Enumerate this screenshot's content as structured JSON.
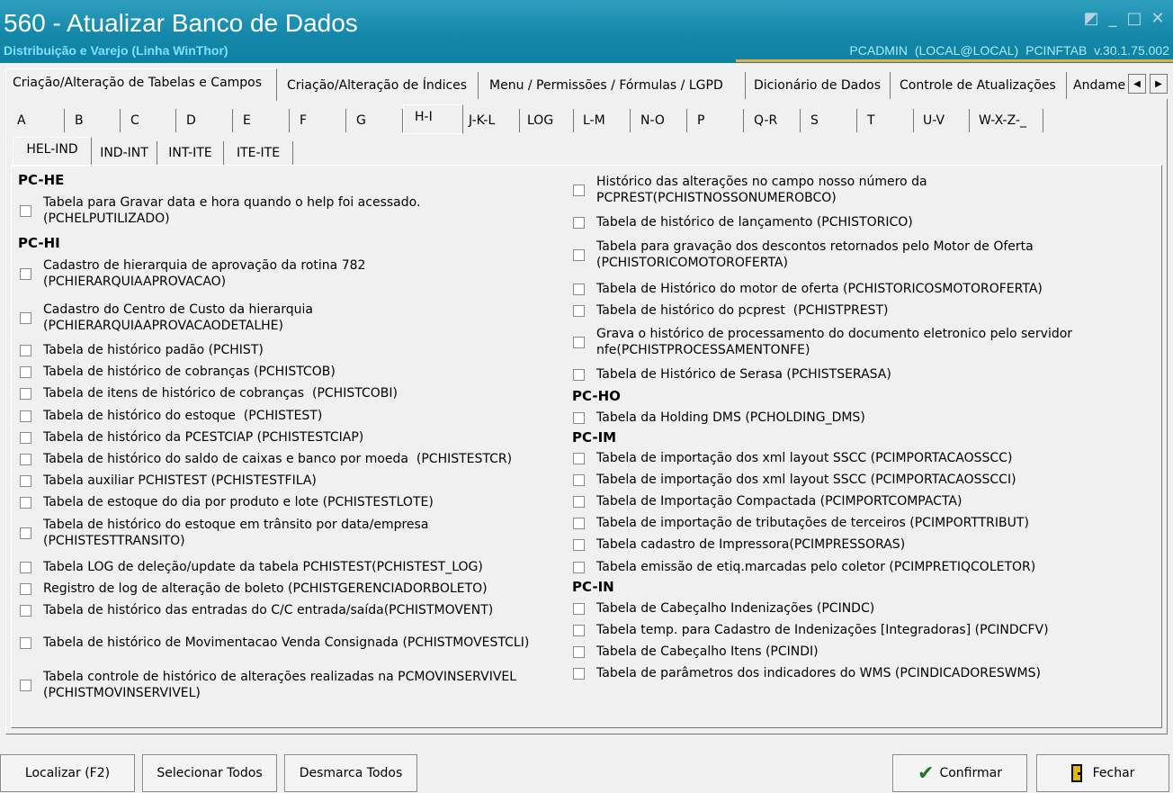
{
  "window": {
    "title": "560 - Atualizar Banco de Dados",
    "subtitle": "Distribuição e Varejo (Linha WinThor)",
    "user_info": "PCADMIN (LOCAL@LOCAL)   PCINFTAB  v.30.1.75.002",
    "restore_glyph": "◩",
    "minimize_glyph": "_",
    "maximize_glyph": "□",
    "close_glyph": "✕"
  },
  "main_tabs": [
    {
      "label": "Criação/Alteração de Tabelas e Campos"
    },
    {
      "label": "Criação/Alteração de Índices"
    },
    {
      "label": "Menu / Permissões / Fórmulas / LGPD"
    },
    {
      "label": "Dicionário de Dados"
    },
    {
      "label": "Controle de Atualizações"
    },
    {
      "label": "Andamento"
    }
  ],
  "scroll": {
    "left": "◀",
    "right": "▶"
  },
  "letter_tabs": [
    "A",
    "B",
    "C",
    "D",
    "E",
    "F",
    "G",
    "H-I",
    "J-K-L",
    "LOG",
    "L-M",
    "N-O",
    "P",
    "Q-R",
    "S",
    "T",
    "U-V",
    "W-X-Z-_"
  ],
  "sub_tabs": [
    "HEL-IND",
    "IND-INT",
    "INT-ITE",
    "ITE-ITE"
  ],
  "left_groups": [
    {
      "title": "PC-HE",
      "items": [
        {
          "label": "Tabela para Gravar data e hora quando o help foi acessado.\n(PCHELPUTILIZADO)"
        }
      ]
    },
    {
      "title": "PC-HI",
      "items": [
        {
          "label": "Cadastro de hierarquia de aprovação da rotina 782\n(PCHIERARQUIAAPROVACAO)"
        },
        {
          "label": "Cadastro do Centro de Custo da hierarquia\n(PCHIERARQUIAAPROVACAODETALHE)"
        },
        {
          "label": "Tabela de histórico padão (PCHIST)"
        },
        {
          "label": "Tabela de histórico de cobranças (PCHISTCOB)"
        },
        {
          "label": "Tabela de itens de histórico de cobranças  (PCHISTCOBI)"
        },
        {
          "label": "Tabela de histórico do estoque  (PCHISTEST)"
        },
        {
          "label": "Tabela de histórico da PCESTCIAP (PCHISTESTCIAP)"
        },
        {
          "label": "Tabela de histórico do saldo de caixas e banco por moeda  (PCHISTESTCR)"
        },
        {
          "label": "Tabela auxiliar PCHISTEST (PCHISTESTFILA)"
        },
        {
          "label": "Tabela de estoque do dia por produto e lote (PCHISTESTLOTE)"
        },
        {
          "label": "Tabela de histórico do estoque em trânsito por data/empresa\n(PCHISTESTTRANSITO)"
        },
        {
          "label": "Tabela LOG de deleção/update da tabela PCHISTEST(PCHISTEST_LOG)"
        },
        {
          "label": "Registro de log de alteração de boleto (PCHISTGERENCIADORBOLETO)"
        },
        {
          "label": "Tabela de histórico das entradas do C/C entrada/saída(PCHISTMOVENT)"
        },
        {
          "label": "Tabela de histórico de Movimentacao Venda Consignada (PCHISTMOVESTCLI)"
        },
        {
          "label": "Tabela controle de histórico de alterações realizadas na PCMOVINSERVIVEL\n(PCHISTMOVINSERVIVEL)"
        }
      ]
    }
  ],
  "right_groups": [
    {
      "title": "",
      "items": [
        {
          "label": "Histórico das alterações no campo nosso número da\nPCPREST(PCHISTNOSSONUMEROBCO)"
        },
        {
          "label": "Tabela de histórico de lançamento (PCHISTORICO)"
        },
        {
          "label": "Tabela para gravação dos descontos retornados pelo Motor de Oferta\n(PCHISTORICOMOTOROFERTA)"
        },
        {
          "label": "Tabela de Histórico do motor de oferta (PCHISTORICOSMOTOROFERTA)"
        },
        {
          "label": "Tabela de histórico do pcprest  (PCHISTPREST)"
        },
        {
          "label": "Grava o histórico de processamento do documento eletronico pelo servidor\nnfe(PCHISTPROCESSAMENTONFE)"
        },
        {
          "label": "Tabela de Histórico de Serasa (PCHISTSERASA)"
        }
      ]
    },
    {
      "title": "PC-HO",
      "items": [
        {
          "label": "Tabela da Holding DMS (PCHOLDING_DMS)"
        }
      ]
    },
    {
      "title": "PC-IM",
      "items": [
        {
          "label": "Tabela de importação dos xml layout SSCC (PCIMPORTACAOSSCC)"
        },
        {
          "label": "Tabela de importação dos xml layout SSCC (PCIMPORTACAOSSCCI)"
        },
        {
          "label": "Tabela de Importação Compactada (PCIMPORTCOMPACTA)"
        },
        {
          "label": "Tabela de importação de tributações de terceiros (PCIMPORTTRIBUT)"
        },
        {
          "label": "Tabela cadastro de Impressora(PCIMPRESSORAS)"
        },
        {
          "label": "Tabela emissão de etiq.marcadas pelo coletor (PCIMPRETIQCOLETOR)"
        }
      ]
    },
    {
      "title": "PC-IN",
      "items": [
        {
          "label": "Tabela de Cabeçalho Indenizações (PCINDC)"
        },
        {
          "label": "Tabela temp. para Cadastro de Indenizações [Integradoras] (PCINDCFV)"
        },
        {
          "label": "Tabela de Cabeçalho Itens (PCINDI)"
        },
        {
          "label": "Tabela de parâmetros dos indicadores do WMS (PCINDICADORESWMS)"
        }
      ]
    }
  ],
  "buttons": {
    "localizar": "Localizar (F2)",
    "selecionar": "Selecionar Todos",
    "desmarca": "Desmarca Todos",
    "confirmar": "Confirmar",
    "fechar": "Fechar"
  }
}
